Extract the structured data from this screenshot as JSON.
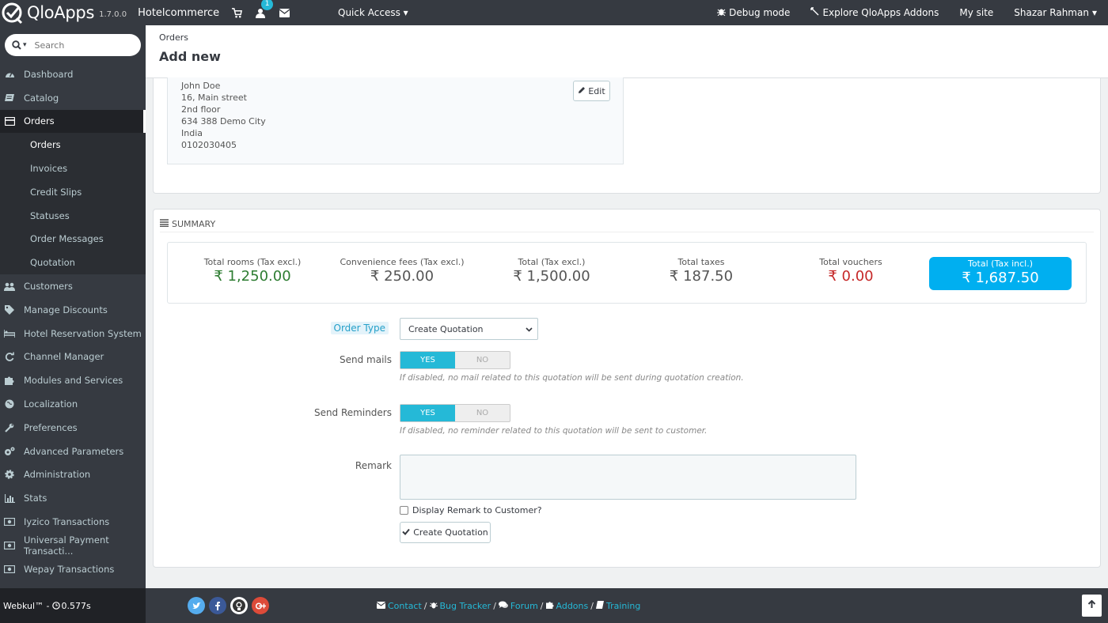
{
  "topbar": {
    "logo_text": "QloApps",
    "version": "1.7.0.0",
    "shop_name": "Hotelcommerce",
    "notification_count": "1",
    "quick_access": "Quick Access",
    "debug_mode": "Debug mode",
    "explore_addons": "Explore QloApps Addons",
    "my_site": "My site",
    "user_name": "Shazar Rahman"
  },
  "sidebar": {
    "search_placeholder": "Search",
    "items": [
      {
        "label": "Dashboard",
        "icon": "dashboard-icon"
      },
      {
        "label": "Catalog",
        "icon": "catalog-icon"
      },
      {
        "label": "Orders",
        "icon": "orders-icon"
      },
      {
        "label": "Customers",
        "icon": "customers-icon"
      },
      {
        "label": "Manage Discounts",
        "icon": "discounts-icon"
      },
      {
        "label": "Hotel Reservation System",
        "icon": "bed-icon"
      },
      {
        "label": "Channel Manager",
        "icon": "refresh-icon"
      },
      {
        "label": "Modules and Services",
        "icon": "puzzle-icon"
      },
      {
        "label": "Localization",
        "icon": "globe-icon"
      },
      {
        "label": "Preferences",
        "icon": "wrench-icon"
      },
      {
        "label": "Advanced Parameters",
        "icon": "cogs-icon"
      },
      {
        "label": "Administration",
        "icon": "gear-icon"
      },
      {
        "label": "Stats",
        "icon": "bar-chart-icon"
      },
      {
        "label": "Iyzico Transactions",
        "icon": "money-icon"
      },
      {
        "label": "Universal Payment Transacti...",
        "icon": "money-icon"
      },
      {
        "label": "Wepay Transactions",
        "icon": "money-icon"
      }
    ],
    "sub_items": [
      "Orders",
      "Invoices",
      "Credit Slips",
      "Statuses",
      "Order Messages",
      "Quotation"
    ],
    "footer_brand": "Webkul™ -",
    "footer_time": "0.577s"
  },
  "header": {
    "breadcrumb": "Orders",
    "title": "Add new"
  },
  "address": {
    "lines": [
      "John Doe",
      "16, Main street",
      "2nd floor",
      "634 388 Demo City",
      "India",
      "0102030405"
    ],
    "edit_label": "Edit"
  },
  "summary": {
    "heading": "Summary",
    "stats": [
      {
        "label": "Total rooms (Tax excl.)",
        "value": "₹ 1,250.00"
      },
      {
        "label": "Convenience fees (Tax excl.)",
        "value": "₹ 250.00"
      },
      {
        "label": "Total (Tax excl.)",
        "value": "₹ 1,500.00"
      },
      {
        "label": "Total taxes",
        "value": "₹ 187.50"
      },
      {
        "label": "Total vouchers",
        "value": "₹ 0.00"
      },
      {
        "label": "Total (Tax incl.)",
        "value": "₹ 1,687.50"
      }
    ]
  },
  "form": {
    "order_type_label": "Order Type",
    "order_type_value": "Create Quotation",
    "send_mails_label": "Send mails",
    "send_mails_yes": "YES",
    "send_mails_no": "NO",
    "send_mails_help": "If disabled, no mail related to this quotation will be sent during quotation creation.",
    "send_reminders_label": "Send Reminders",
    "send_reminders_yes": "YES",
    "send_reminders_no": "NO",
    "send_reminders_help": "If disabled, no reminder related to this quotation will be sent to customer.",
    "remark_label": "Remark",
    "display_remark_label": "Display Remark to Customer?",
    "submit_label": "Create Quotation"
  },
  "footer": {
    "links": [
      "Contact",
      "Bug Tracker",
      "Forum",
      "Addons",
      "Training"
    ],
    "separator": "/"
  },
  "colors": {
    "accent": "#25b9d7",
    "highlight_total": "#00aff0",
    "positive": "#2e7d32",
    "negative": "#c62828",
    "sidebar_bg": "#363a41"
  }
}
